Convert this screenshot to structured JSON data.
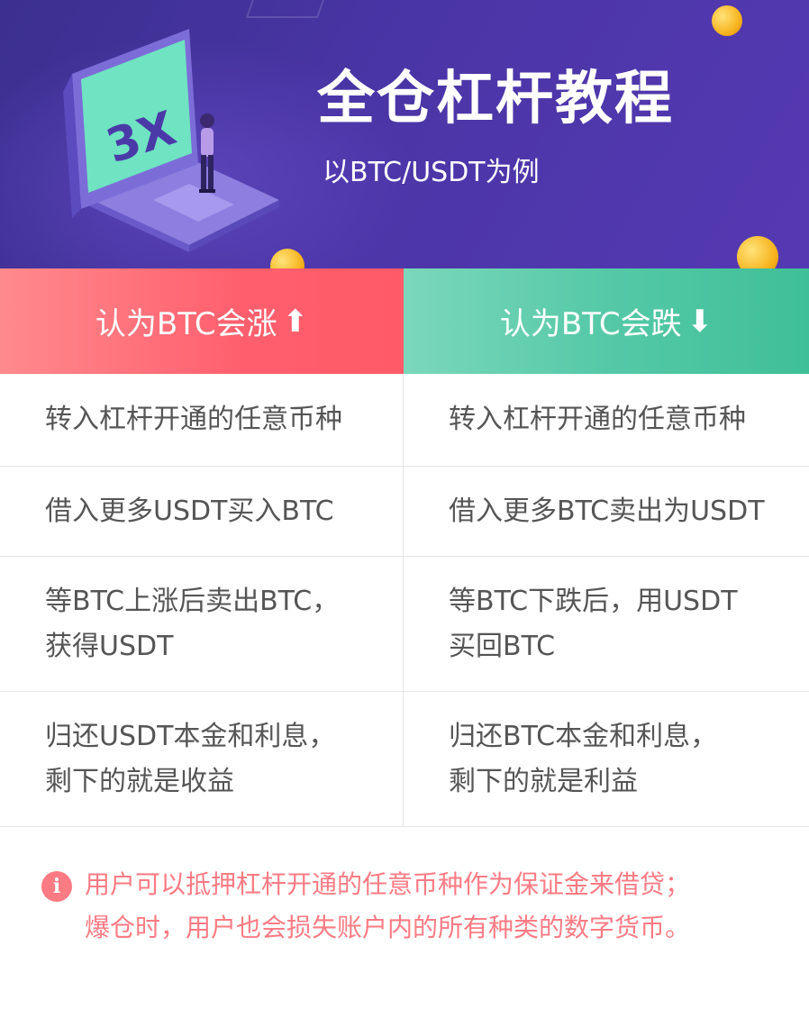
{
  "header": {
    "title": "全仓杠杆教程",
    "subtitle": "以BTC/USDT为例",
    "illustration_text": "3X"
  },
  "columns": {
    "up": {
      "label": "认为BTC会涨",
      "arrow": "⬆",
      "color": "#ff5f6d"
    },
    "down": {
      "label": "认为BTC会跌",
      "arrow": "⬇",
      "color": "#3fbf98"
    }
  },
  "rows": [
    {
      "left": "转入杠杆开通的任意币种",
      "right": "转入杠杆开通的任意币种"
    },
    {
      "left": "借入更多USDT买入BTC",
      "right": "借入更多BTC卖出为USDT"
    },
    {
      "left": "等BTC上涨后卖出BTC，\n获得USDT",
      "right": "等BTC下跌后，用USDT\n买回BTC"
    },
    {
      "left": "归还USDT本金和利息，\n剩下的就是收益",
      "right": "归还BTC本金和利息，\n剩下的就是利益"
    }
  ],
  "note": {
    "icon": "info-icon",
    "icon_glyph": "i",
    "line1": "用户可以抵押杠杆开通的任意币种作为保证金来借贷；",
    "line2": "爆仓时，用户也会损失账户内的所有种类的数字货币。",
    "color": "#ff7b84"
  }
}
